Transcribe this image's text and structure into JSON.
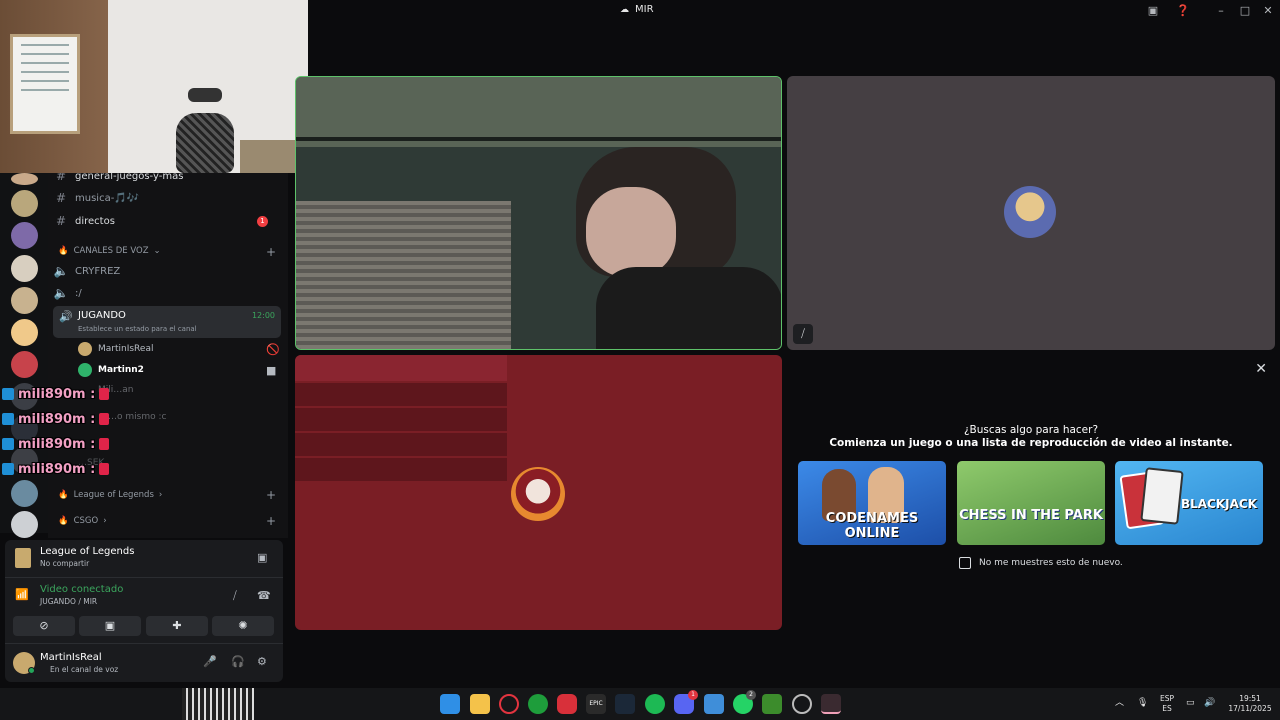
{
  "window": {
    "title": "MIR"
  },
  "channels": {
    "text": [
      {
        "name": "general-juegos-y-mas"
      },
      {
        "name": "musica-🎵🎶"
      },
      {
        "name": "directos",
        "badge": "1"
      }
    ],
    "voice_category": "CANALES DE VOZ",
    "voice": [
      {
        "name": "CRYFREZ"
      },
      {
        "name": ":/"
      }
    ],
    "active_voice": {
      "name": "JUGANDO",
      "time": "12:00",
      "status": "Establece un estado para el canal",
      "members": [
        "MartinIsReal",
        "Martinn2"
      ]
    },
    "partial_rows": [
      "Mili…an",
      "…o mismo :c",
      "…SEK"
    ],
    "categories": [
      "League of Legends",
      "CSGO"
    ]
  },
  "chat_overlay": {
    "user": "mili890m :",
    "count": 4
  },
  "panel": {
    "activity_title": "League of Legends",
    "activity_sub": "No compartir",
    "voice_status": "Video conectado",
    "voice_channel": "JUGANDO / MIR",
    "user_name": "MartinIsReal",
    "user_status": "En el canal de voz"
  },
  "activity": {
    "question": "¿Buscas algo para hacer?",
    "subtitle": "Comienza un juego o una lista de reproducción de video al instante.",
    "cards": [
      {
        "label": "CODENAMES ONLINE",
        "color": "#2f6fd1"
      },
      {
        "label": "CHESS IN THE PARK",
        "color": "#6aa34e"
      },
      {
        "label": "BLACKJACK",
        "color": "#3aa0e8"
      }
    ],
    "checkbox_label": "No me muestres esto de nuevo."
  },
  "taskbar": {
    "lang1": "ESP",
    "lang2": "ES",
    "time": "19:51",
    "date": "17/11/2025",
    "discord_badge": "1",
    "whatsapp_badge": "2"
  },
  "colors": {
    "accent_green": "#5ec26a",
    "tile_red": "#7a1e25",
    "tile_gray": "#453f43"
  }
}
